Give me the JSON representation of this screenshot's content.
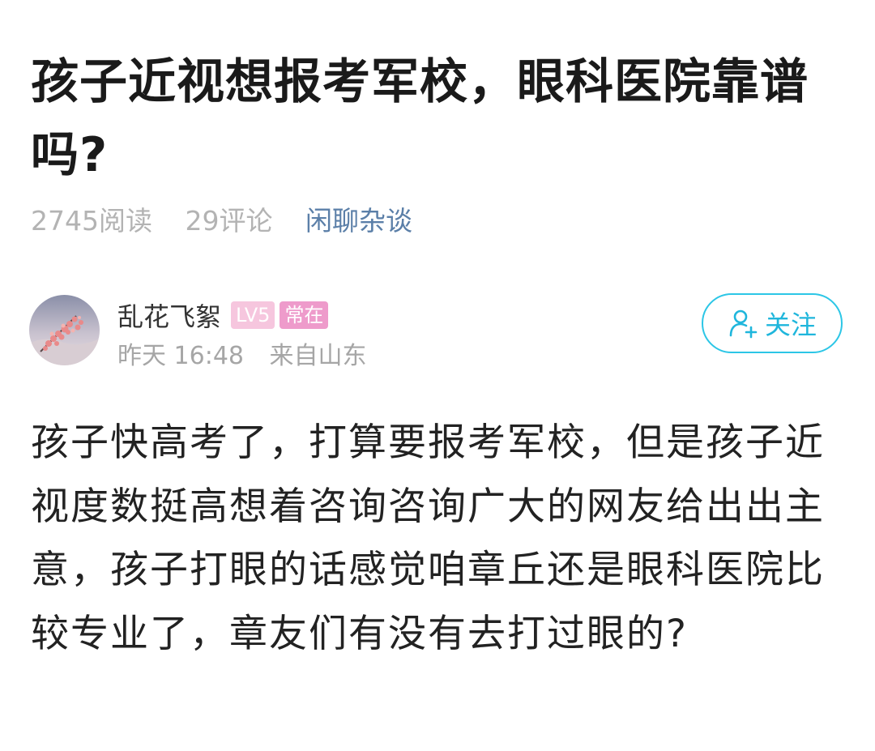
{
  "post": {
    "title": "孩子近视想报考军校，眼科医院靠谱吗?",
    "read_count": "2745阅读",
    "comment_count": "29评论",
    "category": "闲聊杂谈",
    "content": "孩子快高考了，打算要报考军校，但是孩子近视度数挺高想着咨询咨询广大的网友给出出主意，孩子打眼的话感觉咱章丘还是眼科医院比较专业了，章友们有没有去打过眼的?"
  },
  "author": {
    "name": "乱花飞絮",
    "level": "LV5",
    "status_badge": "常在",
    "time": "昨天 16:48",
    "location": "来自山东",
    "avatar_icon": "avatar-flower-image"
  },
  "actions": {
    "follow_label": "关注",
    "follow_icon": "add-user-icon"
  },
  "colors": {
    "accent": "#2cc6e6",
    "category": "#5b7fa8",
    "level_badge": "#f6c6de",
    "status_badge": "#ee9bcb"
  }
}
